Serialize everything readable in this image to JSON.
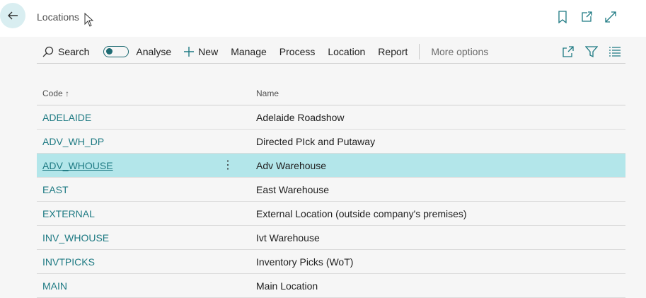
{
  "header": {
    "title": "Locations",
    "icons": [
      "back-arrow-icon",
      "bookmark-icon",
      "open-new-window-icon",
      "expand-icon"
    ]
  },
  "toolbar": {
    "search_label": "Search",
    "analyse_label": "Analyse",
    "new_label": "New",
    "manage_label": "Manage",
    "process_label": "Process",
    "location_label": "Location",
    "report_label": "Report",
    "more_label": "More options",
    "right_icons": [
      "share-icon",
      "filter-icon",
      "list-view-icon"
    ]
  },
  "grid": {
    "columns": {
      "code": "Code",
      "name": "Name"
    },
    "sort_indicator": "↑",
    "rows": [
      {
        "code": "ADELAIDE",
        "name": "Adelaide Roadshow"
      },
      {
        "code": "ADV_WH_DP",
        "name": "Directed PIck and Putaway"
      },
      {
        "code": "ADV_WHOUSE",
        "name": "Adv Warehouse"
      },
      {
        "code": "EAST",
        "name": "East Warehouse"
      },
      {
        "code": "EXTERNAL",
        "name": "External Location (outside company's premises)"
      },
      {
        "code": "INV_WHOUSE",
        "name": "Ivt Warehouse"
      },
      {
        "code": "INVTPICKS",
        "name": "Inventory Picks (WoT)"
      },
      {
        "code": "MAIN",
        "name": "Main Location"
      }
    ],
    "selected_row": "ADV_WHOUSE"
  },
  "colors": {
    "accent": "#1e7a83",
    "selected_row": "#b3e6ea",
    "back_button": "#d9eef1"
  }
}
